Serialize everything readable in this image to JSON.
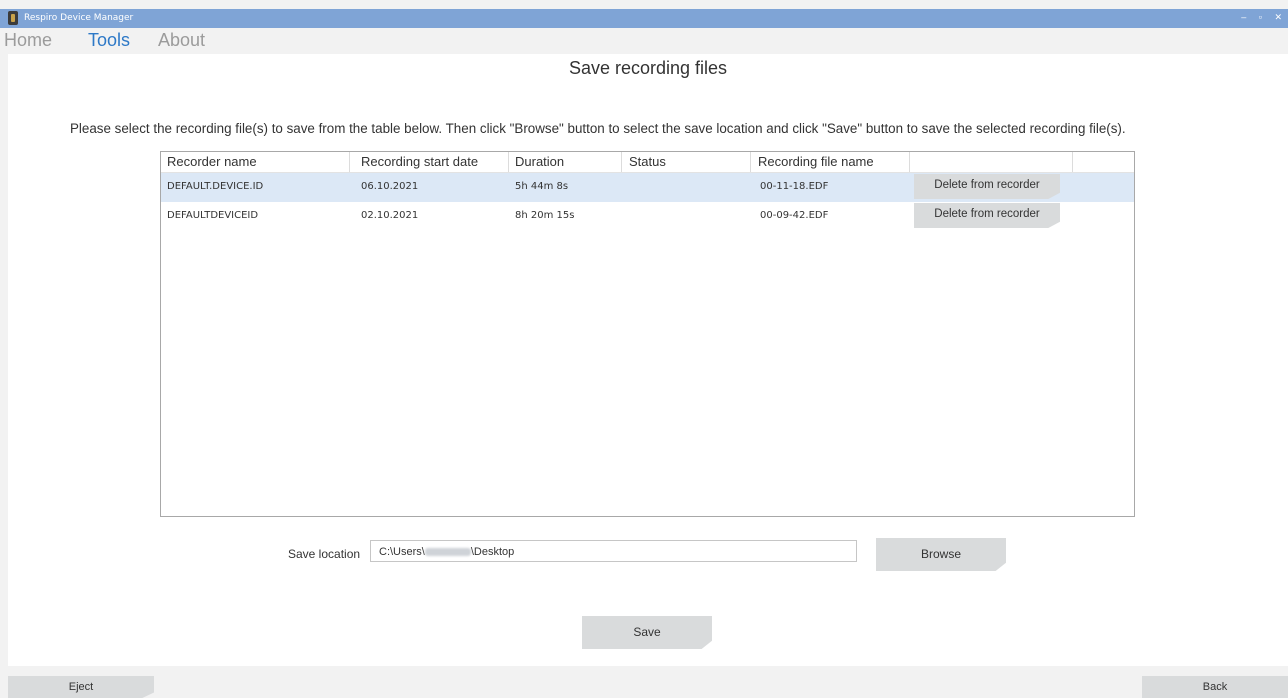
{
  "window": {
    "title": "Respiro Device Manager",
    "minimize": "–",
    "restore": "▫",
    "close": "✕"
  },
  "menu": {
    "home": "Home",
    "tools": "Tools",
    "about": "About",
    "active": "Tools"
  },
  "page": {
    "title": "Save recording files",
    "instructions": "Please select the recording file(s) to save from the table below. Then click \"Browse\" button to select the save location and click \"Save\" button to save the selected recording file(s)."
  },
  "table": {
    "headers": [
      "Recorder name",
      "Recording start date",
      "Duration",
      "Status",
      "Recording file name",
      ""
    ],
    "rows": [
      {
        "recorder_name": "DEFAULT.DEVICE.ID",
        "start_date": "06.10.2021",
        "duration": "5h  44m  8s",
        "status": "",
        "file_name": "00-11-18.EDF",
        "action": "Delete from recorder",
        "selected": true
      },
      {
        "recorder_name": "DEFAULTDEVICEID",
        "start_date": "02.10.2021",
        "duration": "8h  20m  15s",
        "status": "",
        "file_name": "00-09-42.EDF",
        "action": "Delete from recorder",
        "selected": false
      }
    ]
  },
  "save_location": {
    "label": "Save location",
    "value_prefix": "C:\\Users\\",
    "value_suffix": "\\Desktop"
  },
  "buttons": {
    "browse": "Browse",
    "save": "Save",
    "eject": "Eject",
    "back": "Back"
  },
  "colors": {
    "titlebar": "#7fa4d6",
    "menu_active": "#2e79c7",
    "row_selected": "#dce8f6",
    "button": "#d9dbdc"
  }
}
